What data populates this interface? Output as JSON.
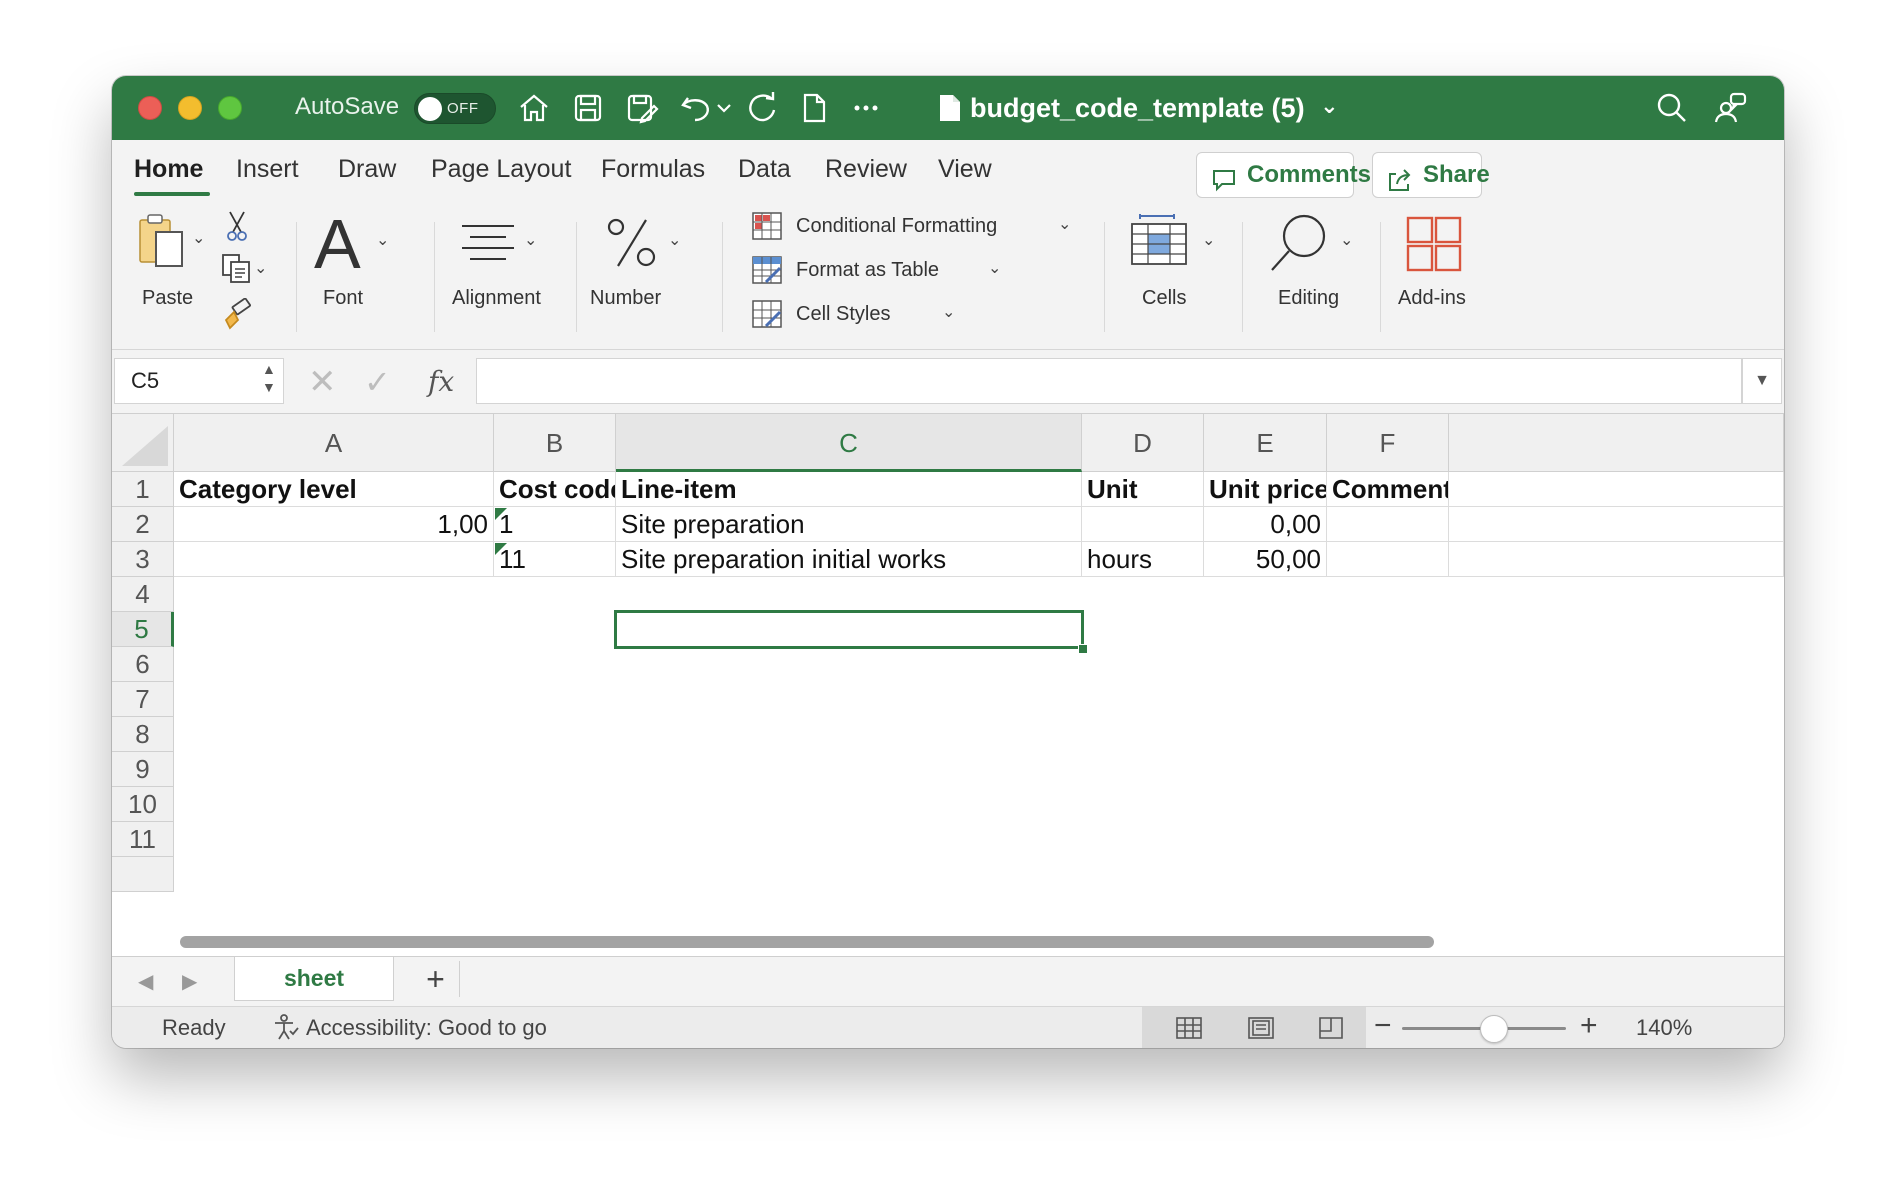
{
  "titlebar": {
    "autosave_label": "AutoSave",
    "toggle_state": "OFF",
    "document_title": "budget_code_template (5)",
    "title_chevron": "⌄"
  },
  "tabs": [
    "Home",
    "Insert",
    "Draw",
    "Page Layout",
    "Formulas",
    "Data",
    "Review",
    "View"
  ],
  "buttons": {
    "comments": "Comments",
    "share": "Share"
  },
  "ribbon": {
    "paste": "Paste",
    "font": "Font",
    "alignment": "Alignment",
    "number": "Number",
    "conditional_formatting": "Conditional Formatting",
    "format_as_table": "Format as Table",
    "cell_styles": "Cell Styles",
    "cells": "Cells",
    "editing": "Editing",
    "addins": "Add-ins"
  },
  "formula_bar": {
    "name_box": "C5",
    "fx": "fx",
    "formula": ""
  },
  "columns": [
    "A",
    "B",
    "C",
    "D",
    "E",
    "F"
  ],
  "rows": [
    "1",
    "2",
    "3",
    "4",
    "5",
    "6",
    "7",
    "8",
    "9",
    "10",
    "11"
  ],
  "cells": {
    "r1": {
      "a": "Category level",
      "b": "Cost code",
      "c": "Line-item",
      "d": "Unit",
      "e": "Unit price",
      "f": "Comment"
    },
    "r2": {
      "a": "1,00",
      "b": "1",
      "c": "Site preparation",
      "d": "",
      "e": "0,00",
      "f": ""
    },
    "r3": {
      "a": "",
      "b": "11",
      "c": "Site preparation initial works",
      "d": "hours",
      "e": "50,00",
      "f": ""
    }
  },
  "selected_cell": "C5",
  "sheet": {
    "tab_name": "sheet",
    "add": "+"
  },
  "status": {
    "ready": "Ready",
    "accessibility": "Accessibility: Good to go",
    "zoom": "140%",
    "zoom_minus": "−",
    "zoom_plus": "+",
    "zoom_level_fraction": 0.56
  },
  "colors": {
    "accent": "#2f7a44",
    "titlebar": "#2f7a44"
  },
  "icons": [
    "home-icon",
    "save-icon",
    "save-as-icon",
    "undo-icon",
    "redo-icon",
    "new-doc-icon",
    "more-icon",
    "search-icon",
    "share-account-icon",
    "comment-icon",
    "share-icon",
    "paste-icon",
    "cut-icon",
    "copy-icon",
    "format-painter-icon",
    "font-icon",
    "alignment-icon",
    "number-icon",
    "conditional-formatting-icon",
    "format-table-icon",
    "cell-styles-icon",
    "cells-icon",
    "editing-icon",
    "addins-icon",
    "accessibility-icon",
    "normal-view-icon",
    "page-layout-icon",
    "page-break-icon"
  ]
}
